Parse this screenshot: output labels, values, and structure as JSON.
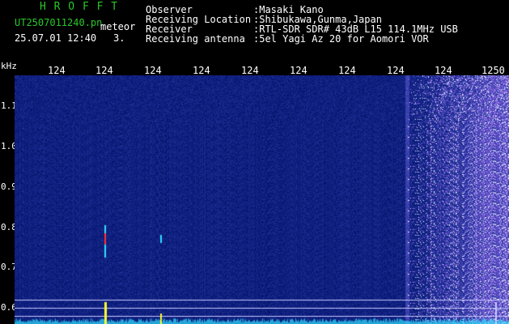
{
  "header": {
    "app_name": "H R O F F T",
    "filename": "UT2507011240.pn",
    "mode_label": "meteor",
    "datetime": "25.07.01 12:40",
    "count": "3.",
    "fields": [
      {
        "label": "Observer",
        "value": ":Masaki Kano"
      },
      {
        "label": "Receiving Location",
        "value": ":Shibukawa,Gunma,Japan"
      },
      {
        "label": "Receiver",
        "value": ":RTL-SDR SDR# 43dB L15 114.1MHz USB"
      },
      {
        "label": "Receiving antenna",
        "value": ":5el Yagi Az 20 for Aomori VOR"
      }
    ]
  },
  "axes": {
    "y_unit": "kHz",
    "y_ticks": [
      "1.1",
      "1.0",
      "0.9",
      "0.8",
      "0.7",
      "0.6"
    ],
    "x_ticks": [
      "124",
      "124",
      "124",
      "124",
      "124",
      "124",
      "124",
      "124",
      "124",
      "1250"
    ]
  },
  "colors": {
    "background": "#000000",
    "noise_dark": "#101850",
    "noise_light": "#5078ff",
    "header_green": "#28c828",
    "text_white": "#ffffff",
    "signal_yellow": "#ffff30",
    "signal_cyan": "#30e0ff",
    "signal_red": "#ff3030",
    "reference_line": "#c8c8ff"
  }
}
